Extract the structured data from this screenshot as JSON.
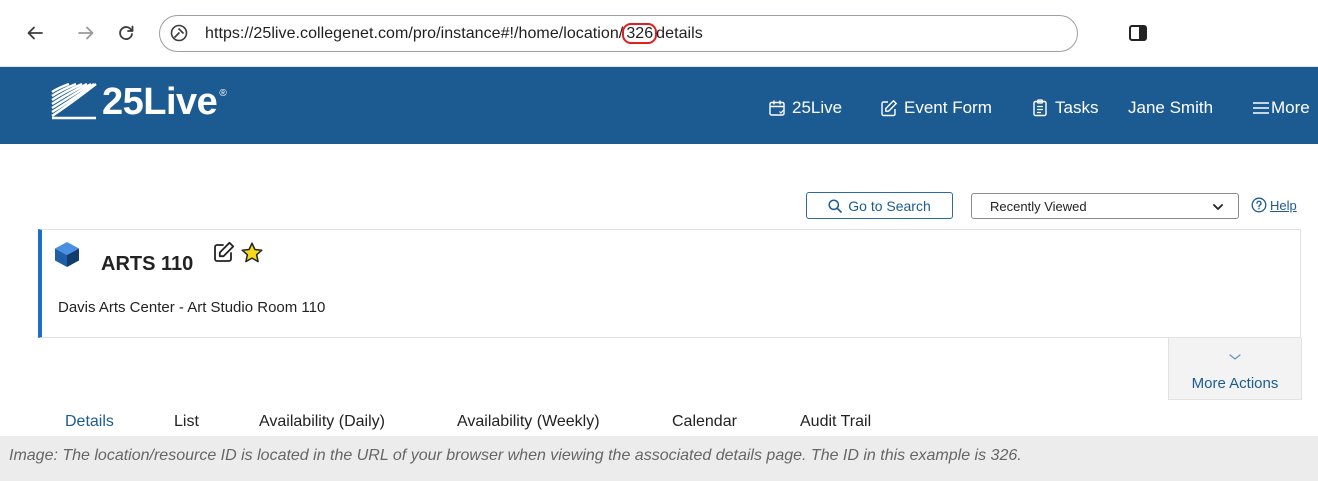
{
  "browser": {
    "url_before": "https://25live.collegenet.com/pro/instance#!/home/location/",
    "url_highlight": "326",
    "url_after": "details"
  },
  "header": {
    "logo_text": "25Live",
    "logo_mark": "®",
    "nav": [
      {
        "label": "25Live",
        "icon": "calendar-icon"
      },
      {
        "label": "Event Form",
        "icon": "edit-icon"
      },
      {
        "label": "Tasks",
        "icon": "clipboard-icon"
      },
      {
        "label": "Jane Smith"
      },
      {
        "label": "More",
        "icon": "menu-icon"
      }
    ],
    "colors": {
      "background": "#1c5b92",
      "text": "#ffffff"
    }
  },
  "toolbar": {
    "search_label": "Go to Search",
    "recent_select_value": "Recently Viewed",
    "help_label": "Help"
  },
  "location": {
    "title": "ARTS 110",
    "subtitle": "Davis Arts Center - Art Studio Room 110",
    "icons": [
      "cube-icon",
      "edit-icon",
      "star-icon"
    ]
  },
  "more_actions_label": "More Actions",
  "tabs": [
    {
      "label": "Details",
      "active": true
    },
    {
      "label": "List"
    },
    {
      "label": "Availability (Daily)"
    },
    {
      "label": "Availability (Weekly)"
    },
    {
      "label": "Calendar"
    },
    {
      "label": "Audit Trail"
    }
  ],
  "caption": "Image: The location/resource ID is located in the URL of your browser when viewing the associated details page. The ID in this example is 326."
}
